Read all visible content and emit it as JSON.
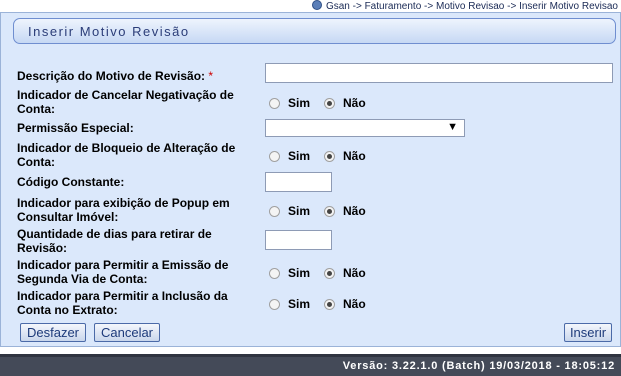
{
  "breadcrumb": {
    "text": "Gsan -> Faturamento -> Motivo Revisao -> Inserir Motivo Revisao"
  },
  "page": {
    "title": "Inserir Motivo Revisão"
  },
  "form": {
    "descricao": {
      "label": "Descrição do Motivo de Revisão:",
      "required_mark": "*",
      "value": ""
    },
    "cancelar_negativacao": {
      "label": "Indicador de Cancelar Negativação de Conta:",
      "sim": "Sim",
      "nao": "Não",
      "selected": "Não"
    },
    "permissao_especial": {
      "label": "Permissão Especial:",
      "selected": ""
    },
    "bloqueio_alteracao": {
      "label": "Indicador de Bloqueio de Alteração de Conta:",
      "sim": "Sim",
      "nao": "Não",
      "selected": "Não"
    },
    "codigo_constante": {
      "label": "Código Constante:",
      "value": ""
    },
    "popup_consultar": {
      "label": "Indicador para exibição de Popup em Consultar Imóvel:",
      "sim": "Sim",
      "nao": "Não",
      "selected": "Não"
    },
    "dias_retirar": {
      "label": "Quantidade de dias para retirar de Revisão:",
      "value": ""
    },
    "segunda_via": {
      "label": "Indicador para Permitir a Emissão de Segunda Via de Conta:",
      "sim": "Sim",
      "nao": "Não",
      "selected": "Não"
    },
    "inclusao_extrato": {
      "label": "Indicador para Permitir a Inclusão da Conta no Extrato:",
      "sim": "Sim",
      "nao": "Não",
      "selected": "Não"
    }
  },
  "buttons": {
    "desfazer": "Desfazer",
    "cancelar": "Cancelar",
    "inserir": "Inserir"
  },
  "footer": {
    "version": "Versão: 3.22.1.0 (Batch) 19/03/2018 - 18:05:12"
  },
  "colors": {
    "panel_bg": "#dbe8fb",
    "title_text": "#2b3d78",
    "footer_bg": "#444a58",
    "required": "#cc0000"
  }
}
